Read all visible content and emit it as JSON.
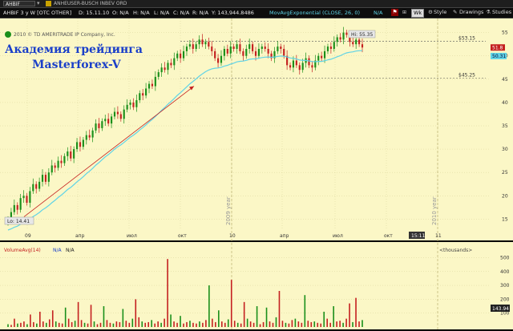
{
  "toolbar": {
    "symbol": "AHBIF",
    "company": "ANHEUSER-BUSCH INBEV ORD",
    "wk_label": "Wk",
    "style_label": "Style",
    "drawings_label": "Drawings",
    "studies_label": "Studies"
  },
  "infobar": {
    "symbol_period": "AHBIF 3 y W [OTC OTHER]",
    "date": "D: 15.11.10",
    "open": "O: N/A",
    "high": "H: N/A",
    "low": "L: N/A",
    "close": "C: N/A",
    "range": "R: N/A",
    "volume": "Y: 143,944.8486",
    "study": "MovAvgExponential (CLOSE, 26, 0)",
    "study_value": "N/A"
  },
  "chart_header": {
    "copyright": "2010 © TD AMERITRADE IP Company, Inc."
  },
  "overlay": {
    "line1": "Академия трейдинга",
    "line2": "Masterforex-V"
  },
  "chart_data": {
    "type": "candlestick",
    "title": "",
    "ylim": [
      13,
      57
    ],
    "yticks": [
      15,
      20,
      25,
      30,
      35,
      40,
      45,
      50,
      55
    ],
    "x_tick_labels": [
      "09",
      "апр",
      "июл",
      "окт",
      "10",
      "апр",
      "июл",
      "окт",
      "11"
    ],
    "year_labels": [
      "2009 year",
      "2010 year"
    ],
    "annotations": {
      "hi_label": "Hi: 55.35",
      "lo_label": "Lo: 14.41",
      "level_upper": "$53.15",
      "level_lower": "$45.25",
      "last_price": "51.8",
      "ema_value": "50.31",
      "time_label": "15:11"
    },
    "ema_color": "#5fd3e6",
    "up_color": "#1a8f1a",
    "down_color": "#c42020",
    "close_series": [
      15.0,
      16.5,
      18.0,
      17.0,
      19.5,
      20.0,
      18.5,
      21.0,
      22.5,
      21.5,
      23.0,
      24.5,
      23.0,
      25.0,
      26.5,
      26.0,
      27.5,
      27.0,
      28.5,
      29.5,
      28.0,
      30.0,
      31.5,
      30.5,
      32.0,
      33.0,
      32.5,
      34.0,
      35.5,
      34.5,
      36.0,
      36.5,
      35.5,
      37.0,
      38.0,
      37.5,
      36.5,
      38.5,
      39.5,
      40.0,
      39.0,
      40.5,
      42.0,
      41.5,
      43.0,
      44.0,
      43.5,
      45.5,
      46.5,
      47.5,
      47.0,
      48.5,
      48.0,
      49.5,
      50.5,
      49.5,
      51.0,
      52.0,
      52.5,
      51.5,
      52.5,
      53.5,
      52.5,
      53.0,
      52.0,
      51.0,
      49.5,
      48.5,
      50.0,
      51.5,
      50.5,
      52.0,
      51.5,
      52.5,
      51.0,
      50.0,
      51.5,
      52.5,
      51.0,
      50.0,
      51.5,
      52.0,
      51.5,
      50.5,
      49.5,
      51.0,
      52.0,
      51.5,
      50.0,
      48.0,
      47.5,
      49.0,
      48.0,
      47.0,
      48.5,
      49.5,
      48.0,
      47.5,
      49.0,
      50.0,
      49.5,
      51.0,
      52.0,
      51.5,
      53.0,
      54.0,
      53.5,
      55.0,
      54.5,
      53.0,
      52.5,
      53.5,
      52.5,
      51.8
    ],
    "volume_panel": {
      "label": "VolumeAvg(14)",
      "label_values": [
        "N/A",
        "N/A"
      ],
      "units": "<thousands>",
      "yticks": [
        100,
        200,
        300,
        400,
        500
      ],
      "ylim": [
        0,
        520
      ],
      "last_volume": "143.94",
      "values": [
        20,
        15,
        60,
        25,
        30,
        40,
        20,
        90,
        35,
        25,
        110,
        40,
        30,
        55,
        120,
        40,
        30,
        25,
        140,
        60,
        35,
        45,
        180,
        50,
        30,
        25,
        160,
        40,
        20,
        30,
        150,
        50,
        30,
        25,
        40,
        35,
        130,
        45,
        30,
        60,
        200,
        70,
        40,
        30,
        35,
        50,
        25,
        40,
        30,
        60,
        490,
        90,
        40,
        30,
        80,
        25,
        35,
        45,
        30,
        25,
        40,
        30,
        50,
        300,
        60,
        35,
        120,
        40,
        30,
        55,
        340,
        45,
        30,
        25,
        180,
        60,
        40,
        30,
        150,
        20,
        35,
        140,
        40,
        30,
        70,
        260,
        45,
        30,
        25,
        50,
        60,
        40,
        30,
        230,
        45,
        35,
        40,
        30,
        25,
        110,
        60,
        30,
        150,
        40,
        45,
        30,
        60,
        170,
        35,
        210,
        40,
        50
      ]
    }
  }
}
